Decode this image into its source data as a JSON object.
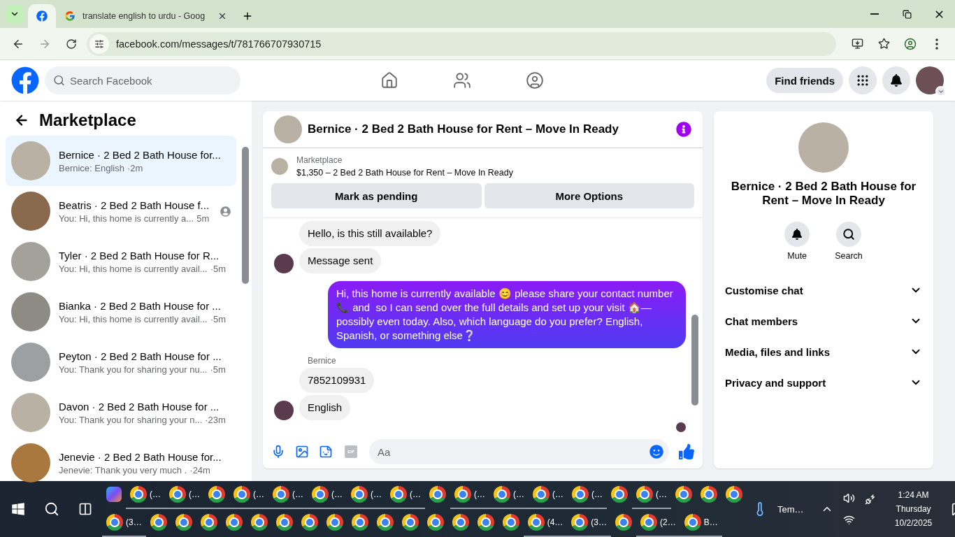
{
  "browser": {
    "tabs": [
      {
        "selected": true
      },
      {
        "title": "translate english to urdu - Goog",
        "selected": false
      }
    ],
    "address": "facebook.com/messages/t/781766707930715"
  },
  "topbar": {
    "search": {
      "placeholder": "Search Facebook"
    },
    "find_friends": "Find friends"
  },
  "sidebar": {
    "title": "Marketplace",
    "conversations": [
      {
        "title": "Bernice · 2 Bed 2 Bath House for...",
        "preview": "Bernice: English",
        "time": "·2m",
        "selected": true,
        "receipt": false
      },
      {
        "title": "Beatris · 2 Bed 2 Bath House f...",
        "preview": "You: Hi, this home is currently a...",
        "time": "5m",
        "selected": false,
        "receipt": true
      },
      {
        "title": "Tyler · 2 Bed 2 Bath House for R...",
        "preview": "You: Hi, this home is currently avail...",
        "time": "·5m",
        "selected": false,
        "receipt": false
      },
      {
        "title": "Bianka · 2 Bed 2 Bath House for ...",
        "preview": "You: Hi, this home is currently avail...",
        "time": "·5m",
        "selected": false,
        "receipt": false
      },
      {
        "title": "Peyton · 2 Bed 2 Bath House for ...",
        "preview": "You: Thank you for sharing your nu...",
        "time": "·5m",
        "selected": false,
        "receipt": false
      },
      {
        "title": "Davon · 2 Bed 2 Bath House for ...",
        "preview": "You: Thank you for sharing your n...",
        "time": "·23m",
        "selected": false,
        "receipt": false
      },
      {
        "title": "Jenevie · 2 Bed 2 Bath House for...",
        "preview": "Jenevie: Thank you very much .",
        "time": "·24m",
        "selected": false,
        "receipt": false
      }
    ]
  },
  "chat": {
    "title": "Bernice · 2 Bed 2 Bath House for Rent – Move In Ready",
    "listing": {
      "label": "Marketplace",
      "text": "$1,350 – 2 Bed 2 Bath House for Rent – Move In Ready"
    },
    "buttons": [
      "Mark as pending",
      "More Options"
    ],
    "messages": [
      {
        "kind": "incoming",
        "text": "Hello, is this still available?"
      },
      {
        "kind": "incoming",
        "text": "Message sent",
        "avatar": true
      },
      {
        "kind": "outgoing",
        "text": "Hi, this home is currently available 😊 please share your contact number 📞 and  so I can send over the full details and set up your visit 🏠—possibly even today. Also, which language do you prefer? English, Spanish, or something else❔"
      },
      {
        "kind": "sender",
        "text": "Bernice"
      },
      {
        "kind": "incoming",
        "text": "7852109931"
      },
      {
        "kind": "incoming",
        "text": "English",
        "avatar": true
      }
    ],
    "composer": {
      "placeholder": "Aa"
    }
  },
  "details": {
    "title": "Bernice · 2 Bed 2 Bath House for Rent – Move In Ready",
    "actions": [
      {
        "kind": "mute",
        "label": "Mute"
      },
      {
        "kind": "search",
        "label": "Search"
      }
    ],
    "sections": [
      {
        "label": "Customise chat",
        "expanded": false
      },
      {
        "label": "Chat members",
        "expanded": false
      },
      {
        "label": "Media, files and links",
        "expanded": false
      },
      {
        "label": "Privacy and support",
        "expanded": false
      }
    ]
  },
  "taskbar": {
    "rows": [
      [
        {
          "kind": "assistant",
          "running": false
        },
        {
          "kind": "browser",
          "label": "(…",
          "running": true
        },
        {
          "kind": "browser",
          "label": "(…",
          "running": true
        },
        {
          "kind": "browser",
          "running": true
        },
        {
          "kind": "browser",
          "label": "(…",
          "running": true
        },
        {
          "kind": "browser",
          "label": "(…",
          "running": true
        },
        {
          "kind": "browser",
          "label": "(…",
          "running": true
        },
        {
          "kind": "browser",
          "label": "(…",
          "running": true
        },
        {
          "kind": "browser",
          "label": "(…",
          "running": true
        },
        {
          "kind": "browser",
          "running": false
        },
        {
          "kind": "browser",
          "label": "(…",
          "running": true
        },
        {
          "kind": "browser",
          "label": "(…",
          "running": true
        },
        {
          "kind": "browser",
          "label": "(…",
          "running": true
        },
        {
          "kind": "browser",
          "label": "(…",
          "running": true
        },
        {
          "kind": "browser",
          "running": false
        },
        {
          "kind": "browser",
          "label": "(…",
          "running": true
        },
        {
          "kind": "browser",
          "running": false
        },
        {
          "kind": "browser",
          "running": false
        },
        {
          "kind": "browser",
          "running": false
        }
      ],
      [
        {
          "kind": "browser",
          "label": "(3…",
          "running": true
        },
        {
          "kind": "browser",
          "running": false
        },
        {
          "kind": "browser",
          "running": false
        },
        {
          "kind": "browser",
          "running": false
        },
        {
          "kind": "browser",
          "running": false
        },
        {
          "kind": "browser",
          "running": false
        },
        {
          "kind": "browser",
          "running": false
        },
        {
          "kind": "browser",
          "running": false
        },
        {
          "kind": "browser",
          "running": false
        },
        {
          "kind": "browser",
          "running": false
        },
        {
          "kind": "browser",
          "running": false
        },
        {
          "kind": "browser",
          "running": false
        },
        {
          "kind": "browser",
          "running": false
        },
        {
          "kind": "browser",
          "running": false
        },
        {
          "kind": "browser",
          "running": false
        },
        {
          "kind": "browser",
          "running": false
        },
        {
          "kind": "browser",
          "label": "(4…",
          "running": true
        },
        {
          "kind": "browser",
          "label": "(3…",
          "running": true
        },
        {
          "kind": "browser",
          "running": false
        },
        {
          "kind": "browser",
          "label": "(2…",
          "running": true
        },
        {
          "kind": "browser",
          "label": "B…",
          "running": true
        }
      ]
    ],
    "weather": "Tem…",
    "time": "1:24 AM",
    "day": "Thursday",
    "date": "10/2/2025"
  }
}
